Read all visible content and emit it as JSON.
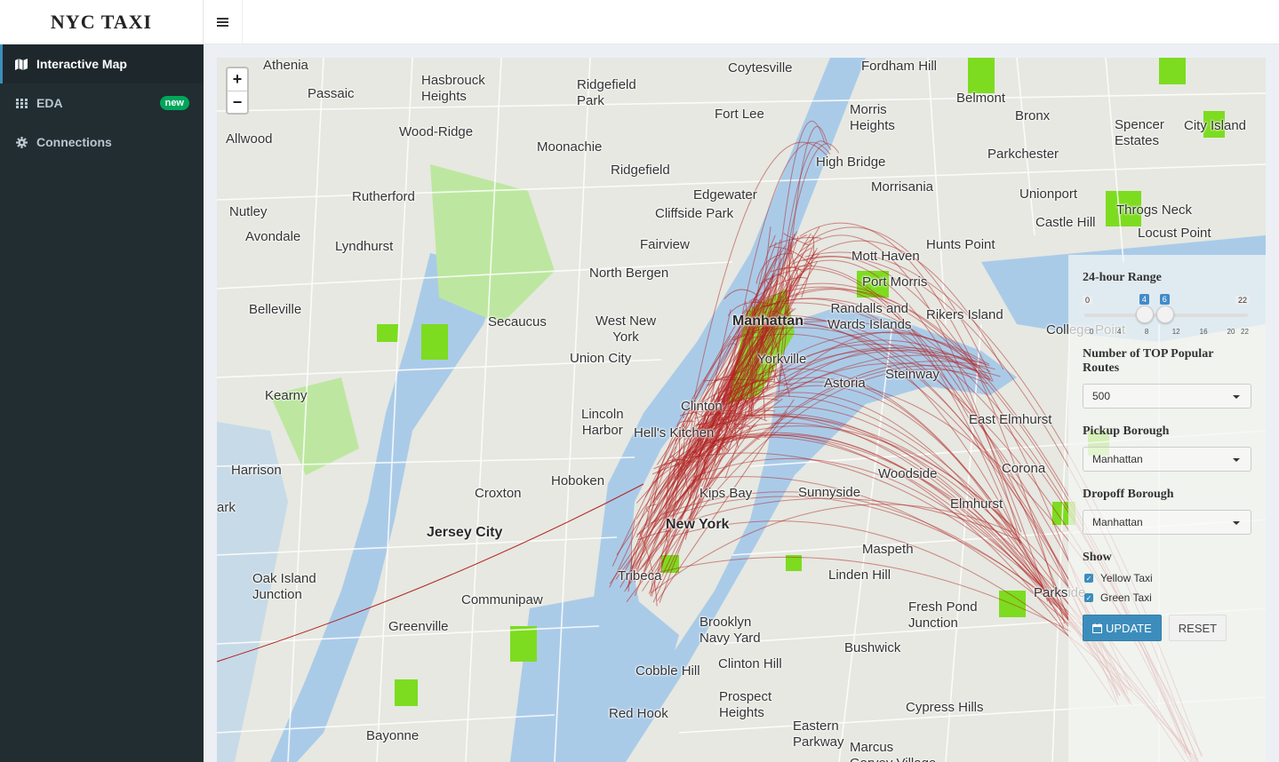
{
  "app": {
    "title": "NYC TAXI"
  },
  "sidebar": {
    "items": [
      {
        "label": "Interactive Map",
        "icon": "map-icon",
        "active": true
      },
      {
        "label": "EDA",
        "icon": "grid-icon",
        "badge": "new"
      },
      {
        "label": "Connections",
        "icon": "gear-icon"
      }
    ]
  },
  "map": {
    "zoom_in": "+",
    "zoom_out": "−",
    "place_labels": [
      "Athenia",
      "Passaic",
      "Hasbrouck Heights",
      "Ridgefield Park",
      "Coytesville",
      "Fordham Hill",
      "Fort Lee",
      "Morris Heights",
      "Belmont",
      "Bronx",
      "Spencer Estates",
      "City Island",
      "Allwood",
      "Wood-Ridge",
      "Moonachie",
      "Ridgefield",
      "High Bridge",
      "Parkchester",
      "Edgewater",
      "Morrisania",
      "Unionport",
      "Rutherford",
      "Cliffside Park",
      "Throgs Neck",
      "Nutley",
      "Castle Hill",
      "Avondale",
      "Lyndhurst",
      "Fairview",
      "Hunts Point",
      "Locust Point",
      "Mott Haven",
      "North Bergen",
      "Port Morris",
      "Belleville",
      "Manhattan",
      "Randalls and Wards Islands",
      "Rikers Island",
      "College Point",
      "Secaucus",
      "West New York",
      "Union City",
      "Yorkville",
      "Astoria",
      "Steinway",
      "Kearny",
      "Lincoln Harbor",
      "Clinton",
      "Hell's Kitchen",
      "East Elmhurst",
      "Harrison",
      "Hoboken",
      "Croxton",
      "Kips Bay",
      "Sunnyside",
      "Woodside",
      "Corona",
      "ark",
      "Jersey City",
      "New York",
      "Elmhurst",
      "Maspeth",
      "Oak Island Junction",
      "Communipaw",
      "Tribeca",
      "Linden Hill",
      "Fresh Pond Junction",
      "Parkside",
      "Greenville",
      "Brooklyn Navy Yard",
      "Bushwick",
      "Clinton Hill",
      "Cobble Hill",
      "Prospect Heights",
      "Cypress Hills",
      "Red Hook",
      "Eastern Parkway",
      "Bayonne",
      "Marcus Garvey Village"
    ]
  },
  "controls": {
    "range_title": "24-hour Range",
    "range_min": 0,
    "range_max": 22,
    "range_from": 4,
    "range_to": 6,
    "range_min_label": "0",
    "range_max_label": "22",
    "range_from_label": "4",
    "range_to_label": "6",
    "range_ticks": [
      "0",
      "4",
      "8",
      "12",
      "16",
      "20",
      "22"
    ],
    "top_routes_title": "Number of TOP Popular Routes",
    "top_routes_value": "500",
    "pickup_title": "Pickup Borough",
    "pickup_value": "Manhattan",
    "dropoff_title": "Dropoff Borough",
    "dropoff_value": "Manhattan",
    "show_title": "Show",
    "yellow_label": "Yellow Taxi",
    "yellow_checked": true,
    "green_label": "Green Taxi",
    "green_checked": true,
    "update_label": "UPDATE",
    "reset_label": "RESET"
  },
  "colors": {
    "route": "#b22222",
    "water": "#aacbe8",
    "park": "#7ddc1f",
    "sidebar": "#222d32"
  }
}
